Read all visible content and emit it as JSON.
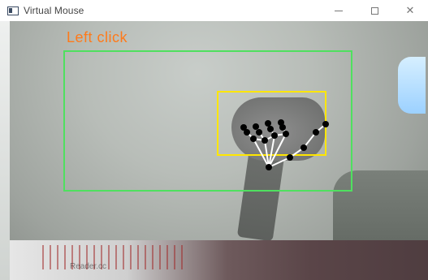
{
  "window": {
    "title": "Virtual Mouse",
    "controls": {
      "minimize": "—",
      "maximize": "□",
      "close": "✕"
    }
  },
  "overlay": {
    "gesture_label": "Left click",
    "watermark": "Reader.cc"
  },
  "colors": {
    "gesture_label": "#ff7a1a",
    "active_region": "#4fe05f",
    "hand_box": "#ffe600",
    "landmark": "#000000",
    "connection": "#ffffff"
  },
  "icons": {
    "app": "window-icon"
  }
}
